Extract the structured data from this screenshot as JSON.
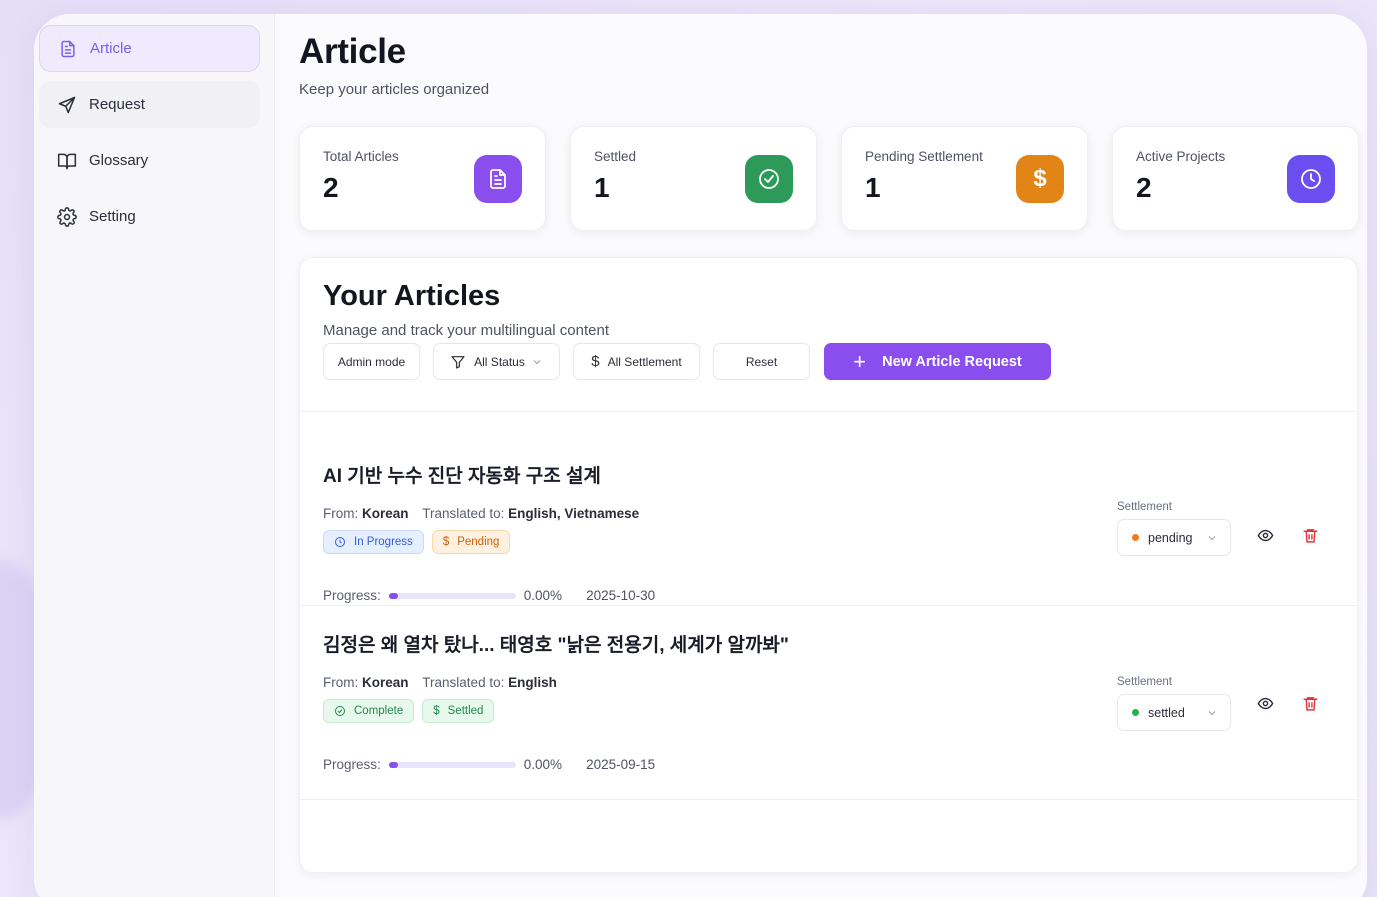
{
  "sidebar": {
    "items": [
      {
        "label": "Article",
        "icon": "document-icon",
        "active": true
      },
      {
        "label": "Request",
        "icon": "send-icon",
        "active": false
      },
      {
        "label": "Glossary",
        "icon": "book-icon",
        "active": false
      },
      {
        "label": "Setting",
        "icon": "gear-icon",
        "active": false
      }
    ]
  },
  "header": {
    "title": "Article",
    "subtitle": "Keep your articles organized"
  },
  "stats": [
    {
      "label": "Total Articles",
      "value": "2",
      "icon": "document-icon",
      "color": "#8a4dee"
    },
    {
      "label": "Settled",
      "value": "1",
      "icon": "check-circle-icon",
      "color": "#2e9a5a"
    },
    {
      "label": "Pending Settlement",
      "value": "1",
      "icon": "dollar-icon",
      "color": "#e28416"
    },
    {
      "label": "Active Projects",
      "value": "2",
      "icon": "clock-icon",
      "color": "#6a4ef0"
    }
  ],
  "articles": {
    "title": "Your Articles",
    "subtitle": "Manage and track your multilingual content",
    "toolbar": {
      "admin_mode": "Admin mode",
      "status_filter": "All Status",
      "settlement_filter": "All Settlement",
      "reset": "Reset",
      "new_request": "New Article Request"
    },
    "list": [
      {
        "title": "AI 기반 누수 진단 자동화 구조 설계",
        "from_label": "From:",
        "from": "Korean",
        "to_label": "Translated to:",
        "to": "English, Vietnamese",
        "status_badge": "In Progress",
        "settlement_badge": "Pending",
        "progress_label": "Progress:",
        "progress": 0,
        "progress_text": "0.00%",
        "date": "2025-10-30",
        "settlement_label": "Settlement",
        "settlement_value": "pending",
        "settlement_color": "#f07a1a"
      },
      {
        "title": "김정은 왜 열차 탔나... 태영호 \"낡은 전용기, 세계가 알까봐\"",
        "from_label": "From:",
        "from": "Korean",
        "to_label": "Translated to:",
        "to": "English",
        "status_badge": "Complete",
        "settlement_badge": "Settled",
        "progress_label": "Progress:",
        "progress": 0,
        "progress_text": "0.00%",
        "date": "2025-09-15",
        "settlement_label": "Settlement",
        "settlement_value": "settled",
        "settlement_color": "#22b14c"
      }
    ]
  },
  "colors": {
    "accent": "#8a4dee",
    "delete": "#e0353b"
  }
}
